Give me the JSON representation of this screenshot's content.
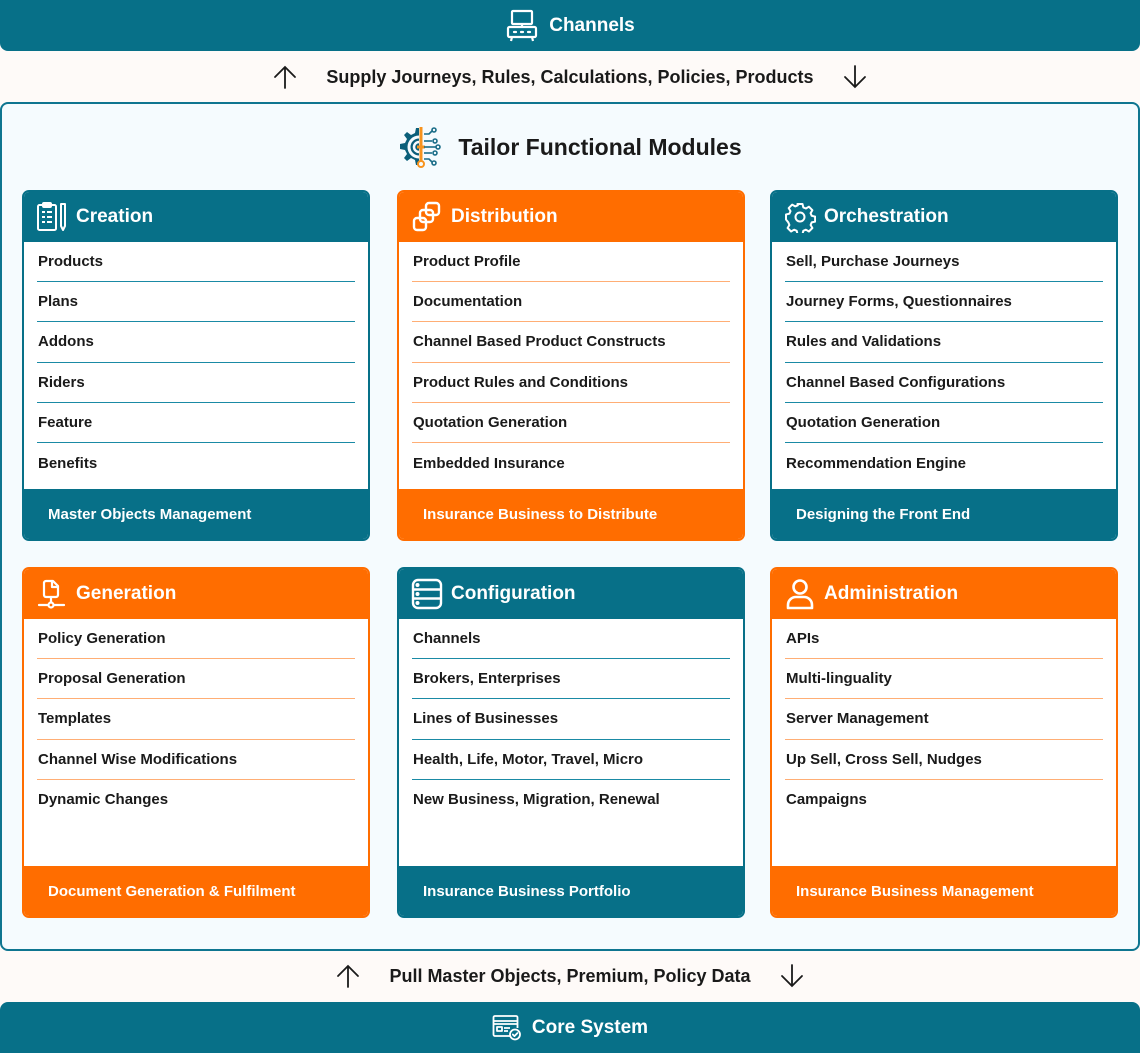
{
  "top_bar": {
    "label": "Channels",
    "icon": "channels-device-icon"
  },
  "top_flow": {
    "label": "Supply Journeys, Rules, Calculations, Policies, Products",
    "left_icon": "arrow-up-icon",
    "right_icon": "arrow-down-icon"
  },
  "container": {
    "title": "Tailor Functional Modules",
    "icon": "gear-circuit-icon"
  },
  "modules": [
    {
      "title": "Creation",
      "theme": "teal",
      "icon": "clipboard-pencil-icon",
      "items": [
        "Products",
        "Plans",
        "Addons",
        "Riders",
        "Feature",
        "Benefits"
      ],
      "footer": "Master Objects Management"
    },
    {
      "title": "Distribution",
      "theme": "orange",
      "icon": "stacked-squares-icon",
      "items": [
        "Product Profile",
        "Documentation",
        "Channel Based Product Constructs",
        "Product Rules and Conditions",
        "Quotation Generation",
        "Embedded Insurance"
      ],
      "footer": "Insurance Business to Distribute"
    },
    {
      "title": "Orchestration",
      "theme": "teal",
      "icon": "gear-icon",
      "items": [
        "Sell, Purchase Journeys",
        "Journey Forms, Questionnaires",
        "Rules and Validations",
        "Channel Based Configurations",
        "Quotation Generation",
        "Recommendation Engine"
      ],
      "footer": "Designing the Front End"
    },
    {
      "title": "Generation",
      "theme": "orange",
      "icon": "document-network-icon",
      "items": [
        "Policy Generation",
        "Proposal Generation",
        "Templates",
        "Channel Wise Modifications",
        "Dynamic Changes"
      ],
      "footer": "Document Generation & Fulfilment"
    },
    {
      "title": "Configuration",
      "theme": "teal",
      "icon": "server-stack-icon",
      "items": [
        "Channels",
        "Brokers, Enterprises",
        "Lines of Businesses",
        "Health, Life, Motor, Travel, Micro",
        "New Business, Migration, Renewal"
      ],
      "footer": "Insurance Business Portfolio"
    },
    {
      "title": "Administration",
      "theme": "orange",
      "icon": "user-icon",
      "items": [
        "APIs",
        "Multi-linguality",
        "Server Management",
        "Up Sell, Cross Sell, Nudges",
        "Campaigns"
      ],
      "footer": "Insurance Business Management"
    }
  ],
  "bottom_flow": {
    "label": "Pull Master Objects, Premium, Policy Data",
    "left_icon": "arrow-up-icon",
    "right_icon": "arrow-down-icon"
  },
  "bottom_bar": {
    "label": "Core System",
    "icon": "core-system-card-icon"
  },
  "colors": {
    "teal": "#077088",
    "orange": "#FF6D00",
    "teal_divider": "#1A8AA5",
    "orange_divider": "#FFAE75"
  }
}
